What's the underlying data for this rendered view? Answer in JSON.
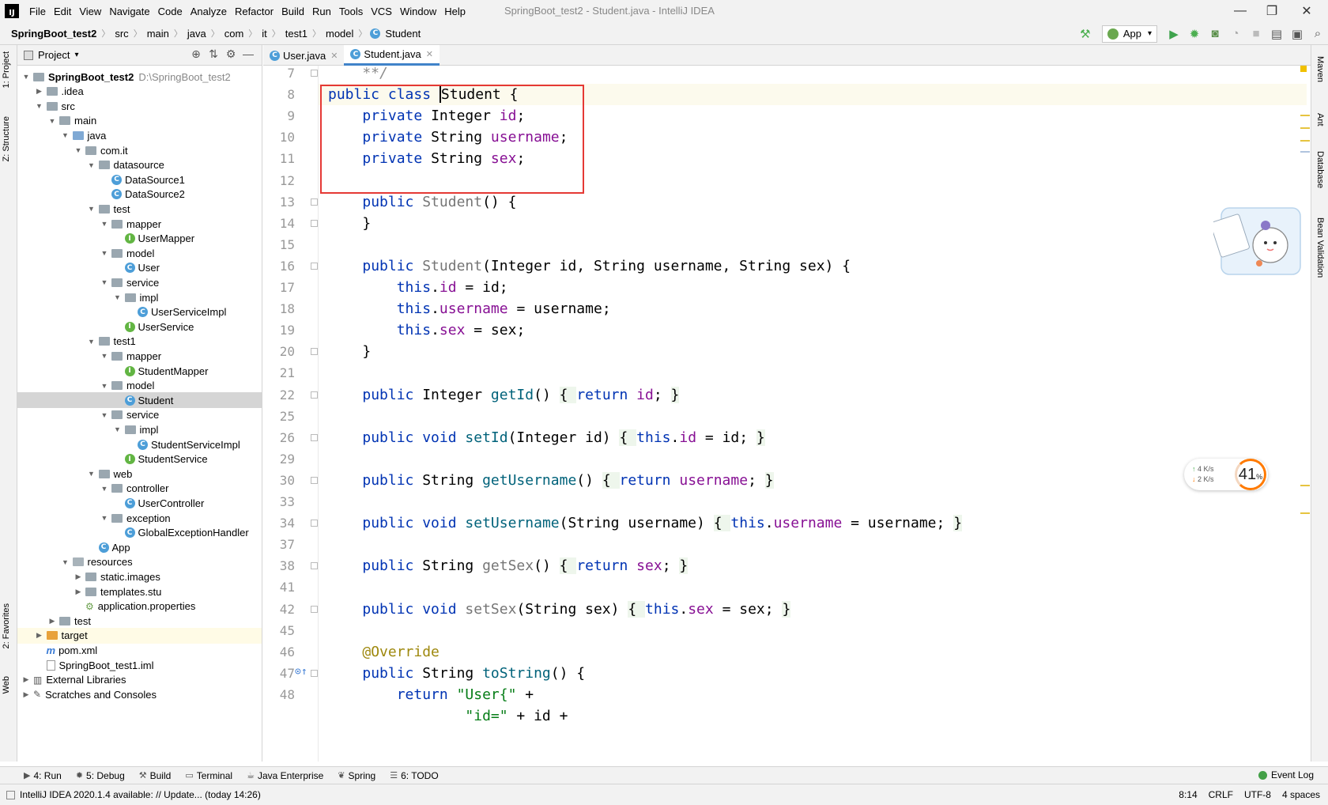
{
  "window": {
    "title": "SpringBoot_test2 - Student.java - IntelliJ IDEA",
    "logo_text": "IJ",
    "controls": {
      "minimize": "—",
      "maximize": "❐",
      "close": "✕"
    }
  },
  "menu": [
    "File",
    "Edit",
    "View",
    "Navigate",
    "Code",
    "Analyze",
    "Refactor",
    "Build",
    "Run",
    "Tools",
    "VCS",
    "Window",
    "Help"
  ],
  "breadcrumb": [
    "SpringBoot_test2",
    "src",
    "main",
    "java",
    "com",
    "it",
    "test1",
    "model",
    "Student"
  ],
  "run_config": {
    "label": "App",
    "arrow": "▾"
  },
  "toolbar_icons": [
    "hammer-icon",
    "run-icon",
    "debug-icon",
    "coverage-icon",
    "profile-icon",
    "stop-icon",
    "project-structure-icon",
    "layout-icon",
    "search-icon"
  ],
  "left_tabs": {
    "project": "1: Project",
    "structure": "Z: Structure",
    "favorites": "2: Favorites",
    "web": "Web"
  },
  "right_tabs": {
    "maven": "Maven",
    "ant": "Ant",
    "database": "Database",
    "bean_validation": "Bean Validation"
  },
  "project_panel": {
    "title": "Project",
    "tree": [
      {
        "label": "SpringBoot_test2",
        "path": "D:\\SpringBoot_test2",
        "depth": 0,
        "arrow": "▼",
        "icon": "module",
        "bold": true
      },
      {
        "label": ".idea",
        "depth": 1,
        "arrow": "▶",
        "icon": "folder"
      },
      {
        "label": "src",
        "depth": 1,
        "arrow": "▼",
        "icon": "folder"
      },
      {
        "label": "main",
        "depth": 2,
        "arrow": "▼",
        "icon": "folder"
      },
      {
        "label": "java",
        "depth": 3,
        "arrow": "▼",
        "icon": "src"
      },
      {
        "label": "com.it",
        "depth": 4,
        "arrow": "▼",
        "icon": "folder"
      },
      {
        "label": "datasource",
        "depth": 5,
        "arrow": "▼",
        "icon": "folder"
      },
      {
        "label": "DataSource1",
        "depth": 6,
        "icon": "class"
      },
      {
        "label": "DataSource2",
        "depth": 6,
        "icon": "class"
      },
      {
        "label": "test",
        "depth": 5,
        "arrow": "▼",
        "icon": "folder"
      },
      {
        "label": "mapper",
        "depth": 6,
        "arrow": "▼",
        "icon": "folder"
      },
      {
        "label": "UserMapper",
        "depth": 7,
        "icon": "interface"
      },
      {
        "label": "model",
        "depth": 6,
        "arrow": "▼",
        "icon": "folder"
      },
      {
        "label": "User",
        "depth": 7,
        "icon": "class"
      },
      {
        "label": "service",
        "depth": 6,
        "arrow": "▼",
        "icon": "folder"
      },
      {
        "label": "impl",
        "depth": 7,
        "arrow": "▼",
        "icon": "folder"
      },
      {
        "label": "UserServiceImpl",
        "depth": 8,
        "icon": "class"
      },
      {
        "label": "UserService",
        "depth": 7,
        "icon": "interface"
      },
      {
        "label": "test1",
        "depth": 5,
        "arrow": "▼",
        "icon": "folder"
      },
      {
        "label": "mapper",
        "depth": 6,
        "arrow": "▼",
        "icon": "folder"
      },
      {
        "label": "StudentMapper",
        "depth": 7,
        "icon": "interface"
      },
      {
        "label": "model",
        "depth": 6,
        "arrow": "▼",
        "icon": "folder"
      },
      {
        "label": "Student",
        "depth": 7,
        "icon": "class",
        "selected": true
      },
      {
        "label": "service",
        "depth": 6,
        "arrow": "▼",
        "icon": "folder"
      },
      {
        "label": "impl",
        "depth": 7,
        "arrow": "▼",
        "icon": "folder"
      },
      {
        "label": "StudentServiceImpl",
        "depth": 8,
        "icon": "class"
      },
      {
        "label": "StudentService",
        "depth": 7,
        "icon": "interface"
      },
      {
        "label": "web",
        "depth": 5,
        "arrow": "▼",
        "icon": "folder"
      },
      {
        "label": "controller",
        "depth": 6,
        "arrow": "▼",
        "icon": "folder"
      },
      {
        "label": "UserController",
        "depth": 7,
        "icon": "class"
      },
      {
        "label": "exception",
        "depth": 6,
        "arrow": "▼",
        "icon": "folder"
      },
      {
        "label": "GlobalExceptionHandler",
        "depth": 7,
        "icon": "class"
      },
      {
        "label": "App",
        "depth": 5,
        "icon": "class"
      },
      {
        "label": "resources",
        "depth": 3,
        "arrow": "▼",
        "icon": "res"
      },
      {
        "label": "static.images",
        "depth": 4,
        "arrow": "▶",
        "icon": "folder"
      },
      {
        "label": "templates.stu",
        "depth": 4,
        "arrow": "▶",
        "icon": "folder"
      },
      {
        "label": "application.properties",
        "depth": 4,
        "icon": "properties"
      },
      {
        "label": "test",
        "depth": 2,
        "arrow": "▶",
        "icon": "folder"
      },
      {
        "label": "target",
        "depth": 1,
        "arrow": "▶",
        "icon": "orange",
        "highlight": true
      },
      {
        "label": "pom.xml",
        "depth": 1,
        "icon": "maven"
      },
      {
        "label": "SpringBoot_test1.iml",
        "depth": 1,
        "icon": "file"
      },
      {
        "label": "External Libraries",
        "depth": 0,
        "arrow": "▶",
        "icon": "lib"
      },
      {
        "label": "Scratches and Consoles",
        "depth": 0,
        "arrow": "▶",
        "icon": "scratch"
      }
    ]
  },
  "editor_tabs": [
    {
      "label": "User.java",
      "active": false
    },
    {
      "label": "Student.java",
      "active": true
    }
  ],
  "editor": {
    "lines": [
      {
        "num": "7",
        "tokens": [
          [
            "cmt",
            "    **/"
          ]
        ]
      },
      {
        "num": "8",
        "current": true,
        "tokens": [
          [
            "kw",
            "public class "
          ],
          [
            "caret",
            ""
          ],
          [
            "",
            "Student {"
          ]
        ]
      },
      {
        "num": "9",
        "tokens": [
          [
            "",
            "    "
          ],
          [
            "kw",
            "private "
          ],
          [
            "",
            "Integer "
          ],
          [
            "fld",
            "id"
          ],
          [
            "",
            ";"
          ]
        ]
      },
      {
        "num": "10",
        "tokens": [
          [
            "",
            "    "
          ],
          [
            "kw",
            "private "
          ],
          [
            "",
            "String "
          ],
          [
            "fld",
            "username"
          ],
          [
            "",
            ";"
          ]
        ]
      },
      {
        "num": "11",
        "tokens": [
          [
            "",
            "    "
          ],
          [
            "kw",
            "private "
          ],
          [
            "",
            "String "
          ],
          [
            "fld",
            "sex"
          ],
          [
            "",
            ";"
          ]
        ]
      },
      {
        "num": "12",
        "tokens": []
      },
      {
        "num": "13",
        "tokens": [
          [
            "",
            "    "
          ],
          [
            "kw",
            "public "
          ],
          [
            "cls-gray",
            "Student"
          ],
          [
            "",
            "() {"
          ]
        ]
      },
      {
        "num": "14",
        "tokens": [
          [
            "",
            "    }"
          ]
        ]
      },
      {
        "num": "15",
        "tokens": []
      },
      {
        "num": "16",
        "tokens": [
          [
            "",
            "    "
          ],
          [
            "kw",
            "public "
          ],
          [
            "cls-gray",
            "Student"
          ],
          [
            "",
            "(Integer id, String username, String sex) {"
          ]
        ]
      },
      {
        "num": "17",
        "tokens": [
          [
            "",
            "        "
          ],
          [
            "kw",
            "this"
          ],
          [
            "",
            "."
          ],
          [
            "fld",
            "id"
          ],
          [
            "",
            " = id;"
          ]
        ]
      },
      {
        "num": "18",
        "tokens": [
          [
            "",
            "        "
          ],
          [
            "kw",
            "this"
          ],
          [
            "",
            "."
          ],
          [
            "fld",
            "username"
          ],
          [
            "",
            " = username;"
          ]
        ]
      },
      {
        "num": "19",
        "tokens": [
          [
            "",
            "        "
          ],
          [
            "kw",
            "this"
          ],
          [
            "",
            "."
          ],
          [
            "fld",
            "sex"
          ],
          [
            "",
            " = sex;"
          ]
        ]
      },
      {
        "num": "20",
        "tokens": [
          [
            "",
            "    }"
          ]
        ]
      },
      {
        "num": "21",
        "tokens": []
      },
      {
        "num": "22",
        "tokens": [
          [
            "",
            "    "
          ],
          [
            "kw",
            "public "
          ],
          [
            "",
            "Integer "
          ],
          [
            "mth",
            "getId"
          ],
          [
            "",
            "() "
          ],
          [
            "fold-brace",
            "{ "
          ],
          [
            "kw",
            "return "
          ],
          [
            "fld",
            "id"
          ],
          [
            "",
            "; "
          ],
          [
            "fold-brace",
            "}"
          ]
        ]
      },
      {
        "num": "25",
        "tokens": []
      },
      {
        "num": "26",
        "tokens": [
          [
            "",
            "    "
          ],
          [
            "kw",
            "public void "
          ],
          [
            "mth",
            "setId"
          ],
          [
            "",
            "(Integer id) "
          ],
          [
            "fold-brace",
            "{ "
          ],
          [
            "kw",
            "this"
          ],
          [
            "",
            "."
          ],
          [
            "fld",
            "id"
          ],
          [
            "",
            " = id; "
          ],
          [
            "fold-brace",
            "}"
          ]
        ]
      },
      {
        "num": "29",
        "tokens": []
      },
      {
        "num": "30",
        "tokens": [
          [
            "",
            "    "
          ],
          [
            "kw",
            "public "
          ],
          [
            "",
            "String "
          ],
          [
            "mth",
            "getUsername"
          ],
          [
            "",
            "() "
          ],
          [
            "fold-brace",
            "{ "
          ],
          [
            "kw",
            "return "
          ],
          [
            "fld",
            "username"
          ],
          [
            "",
            "; "
          ],
          [
            "fold-brace",
            "}"
          ]
        ]
      },
      {
        "num": "33",
        "tokens": []
      },
      {
        "num": "34",
        "tokens": [
          [
            "",
            "    "
          ],
          [
            "kw",
            "public void "
          ],
          [
            "mth",
            "setUsername"
          ],
          [
            "",
            "(String username) "
          ],
          [
            "fold-brace",
            "{ "
          ],
          [
            "kw",
            "this"
          ],
          [
            "",
            "."
          ],
          [
            "fld",
            "username"
          ],
          [
            "",
            " = username; "
          ],
          [
            "fold-brace",
            "}"
          ]
        ]
      },
      {
        "num": "37",
        "tokens": []
      },
      {
        "num": "38",
        "tokens": [
          [
            "",
            "    "
          ],
          [
            "kw",
            "public "
          ],
          [
            "",
            "String "
          ],
          [
            "cls-gray",
            "getSex"
          ],
          [
            "",
            "() "
          ],
          [
            "fold-brace",
            "{ "
          ],
          [
            "kw",
            "return "
          ],
          [
            "fld",
            "sex"
          ],
          [
            "",
            "; "
          ],
          [
            "fold-brace",
            "}"
          ]
        ]
      },
      {
        "num": "41",
        "tokens": []
      },
      {
        "num": "42",
        "tokens": [
          [
            "",
            "    "
          ],
          [
            "kw",
            "public void "
          ],
          [
            "cls-gray",
            "setSex"
          ],
          [
            "",
            "(String sex) "
          ],
          [
            "fold-brace",
            "{ "
          ],
          [
            "kw",
            "this"
          ],
          [
            "",
            "."
          ],
          [
            "fld",
            "sex"
          ],
          [
            "",
            " = sex; "
          ],
          [
            "fold-brace",
            "}"
          ]
        ]
      },
      {
        "num": "45",
        "tokens": []
      },
      {
        "num": "46",
        "tokens": [
          [
            "",
            "    "
          ],
          [
            "ann",
            "@Override"
          ]
        ]
      },
      {
        "num": "47",
        "tokens": [
          [
            "",
            "    "
          ],
          [
            "kw",
            "public "
          ],
          [
            "",
            "String "
          ],
          [
            "mth",
            "toString"
          ],
          [
            "",
            "() {"
          ]
        ]
      },
      {
        "num": "48",
        "tokens": [
          [
            "",
            "        "
          ],
          [
            "kw",
            "return "
          ],
          [
            "str",
            "\"User{\""
          ],
          [
            "",
            " +"
          ]
        ]
      },
      {
        "num": "",
        "tokens": [
          [
            "",
            "                "
          ],
          [
            "str",
            "\"id=\""
          ],
          [
            "",
            " + id +"
          ]
        ]
      }
    ]
  },
  "net_widget": {
    "upload": "4 K/s",
    "download": "2 K/s",
    "up_arrow": "↑",
    "down_arrow": "↓",
    "percent": "41",
    "percent_sign": "%"
  },
  "bottom_tools": [
    {
      "icon": "▶",
      "label": "4: Run"
    },
    {
      "icon": "✹",
      "label": "5: Debug"
    },
    {
      "icon": "⚒",
      "label": "Build"
    },
    {
      "icon": "▭",
      "label": "Terminal"
    },
    {
      "icon": "☕",
      "label": "Java Enterprise"
    },
    {
      "icon": "❦",
      "label": "Spring"
    },
    {
      "icon": "☰",
      "label": "6: TODO"
    }
  ],
  "event_log": "Event Log",
  "status": {
    "message": "IntelliJ IDEA 2020.1.4 available: // Update... (today 14:26)",
    "position": "8:14",
    "line_sep": "CRLF",
    "encoding": "UTF-8",
    "indent": "4 spaces"
  }
}
